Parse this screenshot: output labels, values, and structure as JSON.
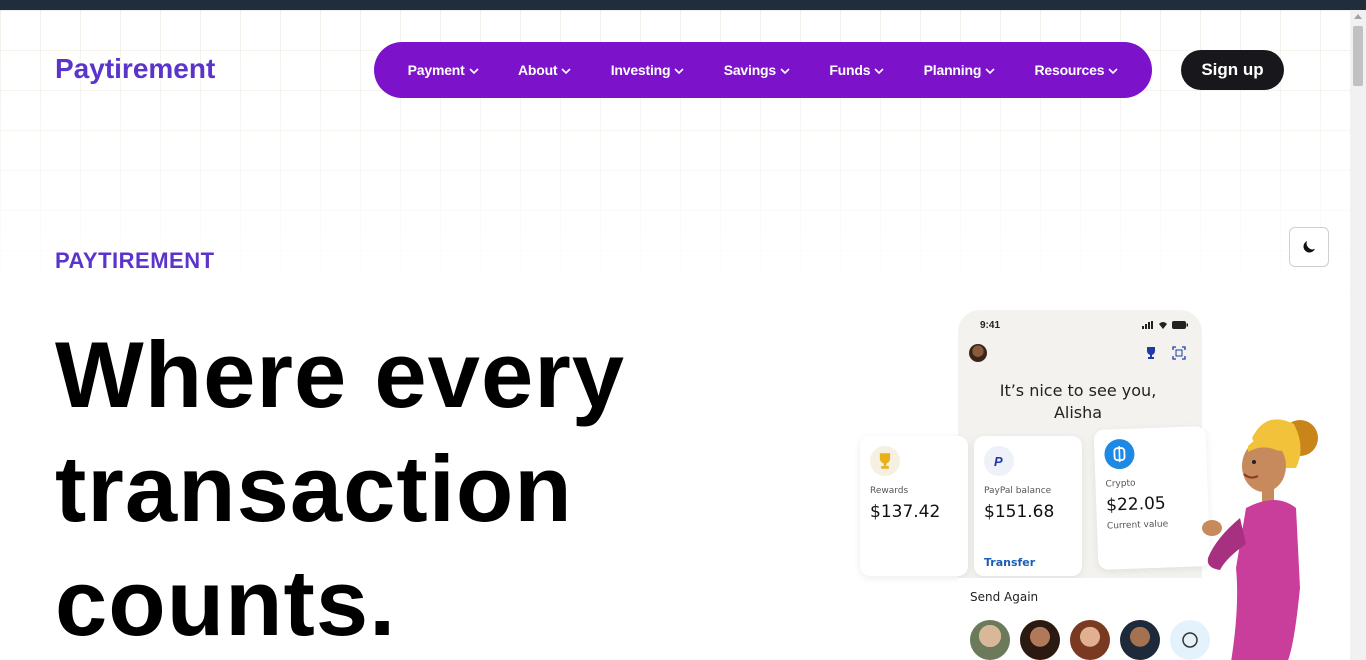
{
  "brand": {
    "name": "Paytirement"
  },
  "nav": {
    "items": [
      {
        "label": "Payment"
      },
      {
        "label": "About"
      },
      {
        "label": "Investing"
      },
      {
        "label": "Savings"
      },
      {
        "label": "Funds"
      },
      {
        "label": "Planning"
      },
      {
        "label": "Resources"
      }
    ]
  },
  "header": {
    "signup_label": "Sign up"
  },
  "hero": {
    "eyebrow": "PAYTIREMENT",
    "line1": "Where every",
    "line2": "transaction",
    "line3": "counts."
  },
  "phone": {
    "time": "9:41",
    "greeting_line1": "It’s nice to see you,",
    "greeting_line2": "Alisha",
    "cards": [
      {
        "label": "Rewards",
        "value": "$137.42",
        "icon": "trophy-icon"
      },
      {
        "label": "PayPal balance",
        "value": "$151.68",
        "link": "Transfer",
        "icon": "paypal-icon"
      },
      {
        "label": "Crypto",
        "value": "$22.05",
        "sub": "Current value",
        "icon": "bitcoin-icon"
      }
    ],
    "send_again": "Send Again"
  },
  "colors": {
    "brand": "#5b35c9",
    "nav_bg": "#7c12c9",
    "signup_bg": "#18171c",
    "link": "#1a5fb4"
  }
}
